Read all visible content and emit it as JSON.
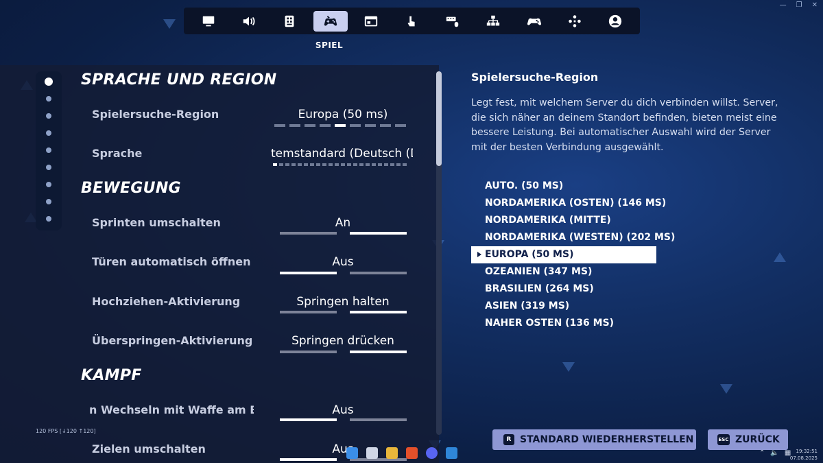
{
  "window_controls": [
    "—",
    "❐",
    "✕"
  ],
  "nav": {
    "tabs": [
      {
        "name": "tab-video",
        "icon": "monitor-icon"
      },
      {
        "name": "tab-audio",
        "icon": "speaker-icon"
      },
      {
        "name": "tab-accessibility",
        "icon": "grid-icon"
      },
      {
        "name": "tab-game",
        "icon": "gamepad-icon",
        "active": true
      },
      {
        "name": "tab-hud",
        "icon": "window-icon"
      },
      {
        "name": "tab-touch",
        "icon": "touch-icon"
      },
      {
        "name": "tab-mouse-keyboard",
        "icon": "keyboard-mouse-icon"
      },
      {
        "name": "tab-controller-layout",
        "icon": "layout-icon"
      },
      {
        "name": "tab-controller",
        "icon": "controller-icon"
      },
      {
        "name": "tab-controls",
        "icon": "dpad-icon"
      },
      {
        "name": "tab-account",
        "icon": "user-icon"
      }
    ],
    "active_label": "SPIEL"
  },
  "settings": {
    "section_language": "SPRACHE UND REGION",
    "matchmaking_label": "Spielersuche-Region",
    "matchmaking_value": "Europa (50 ms)",
    "language_label": "Sprache",
    "language_value": "temstandard (Deutsch (D",
    "section_movement": "BEWEGUNG",
    "sprint_label": "Sprinten umschalten",
    "sprint_value": "An",
    "doors_label": "Türen automatisch öffnen",
    "doors_value": "Aus",
    "mantle_label": "Hochziehen-Aktivierung",
    "mantle_value": "Springen halten",
    "vault_label": "Überspringen-Aktivierung",
    "vault_value": "Springen drücken",
    "section_combat": "KAMPF",
    "switch_label": "n Wechseln mit Waffe am Bo",
    "switch_value": "Aus",
    "aim_label": "Zielen umschalten",
    "aim_value": "Aus"
  },
  "fps_counter": "120 FPS [↓120 ↑120]",
  "info": {
    "title": "Spielersuche-Region",
    "description": "Legt fest, mit welchem Server du dich verbinden willst. Server, die sich näher an deinem Standort befinden, bieten meist eine bessere Leistung. Bei automatischer Auswahl wird der Server mit der besten Verbindung ausgewählt.",
    "options": [
      "AUTO. (50 MS)",
      "NORDAMERIKA (OSTEN) (146 MS)",
      "NORDAMERIKA (MITTE)",
      "NORDAMERIKA (WESTEN) (202 MS)",
      "EUROPA (50 MS)",
      "OZEANIEN (347 MS)",
      "BRASILIEN (264 MS)",
      "ASIEN (319 MS)",
      "NAHER OSTEN (136 MS)"
    ],
    "selected_index": 4
  },
  "buttons": {
    "reset_key": "R",
    "reset_label": "STANDARD WIEDERHERSTELLEN",
    "back_key": "ESC",
    "back_label": "ZURÜCK"
  },
  "taskbar": {
    "time": "19:32:51",
    "date": "07.08.2025",
    "colors": [
      "#3b8ee8",
      "#cfd6e6",
      "#e8b63b",
      "#e4502a",
      "#5865f2",
      "#2f86d8"
    ]
  }
}
